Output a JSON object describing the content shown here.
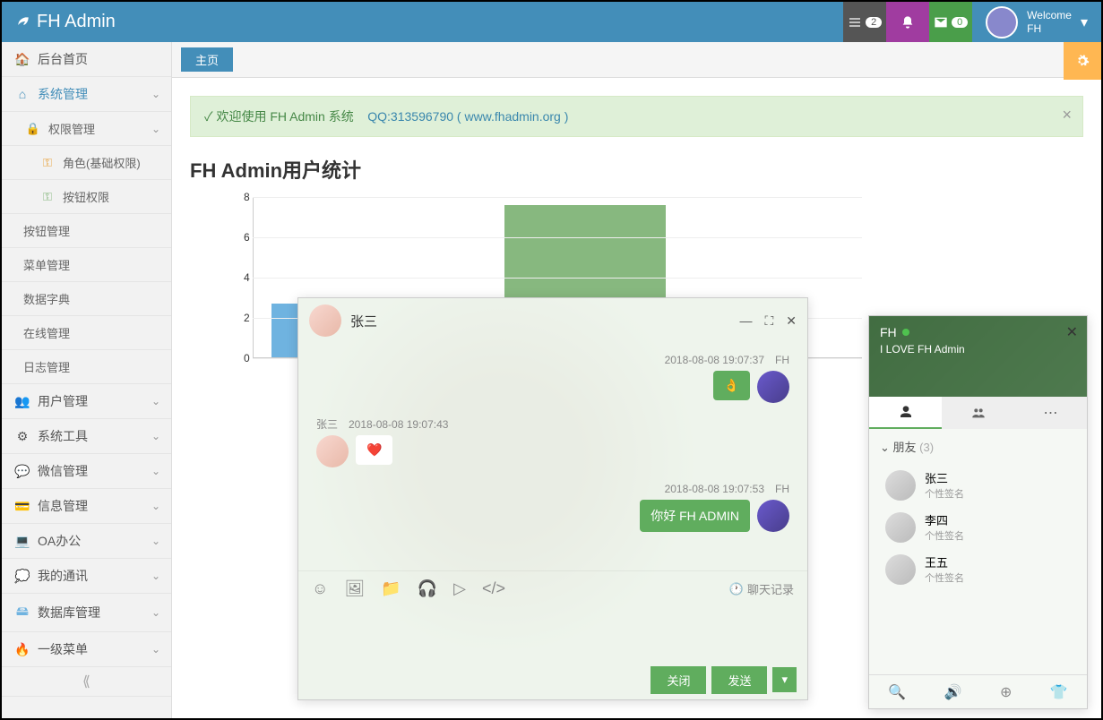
{
  "brand": "FH Admin",
  "header": {
    "badge_gray": "2",
    "badge_green": "0",
    "welcome_label": "Welcome",
    "username": "FH"
  },
  "tabs": {
    "main": "主页"
  },
  "alert": {
    "prefix": "✓ 欢迎使用 FH Admin 系统",
    "qq": "QQ:313596790",
    "link": "( www.fhadmin.org )"
  },
  "sidebar": {
    "home": "后台首页",
    "system": "系统管理",
    "permission": "权限管理",
    "role": "角色(基础权限)",
    "button_perm": "按钮权限",
    "button_mgmt": "按钮管理",
    "menu_mgmt": "菜单管理",
    "dict": "数据字典",
    "online": "在线管理",
    "log": "日志管理",
    "user_mgmt": "用户管理",
    "sys_tools": "系统工具",
    "wechat": "微信管理",
    "info": "信息管理",
    "oa": "OA办公",
    "comm": "我的通讯",
    "db": "数据库管理",
    "level1": "一级菜单"
  },
  "section_title": "FH Admin用户统计",
  "chart_data": {
    "type": "bar",
    "title": "FH Admin用户统计",
    "ylim": [
      0,
      8
    ],
    "yticks": [
      0,
      2,
      4,
      6,
      8
    ],
    "categories": [
      "",
      ""
    ],
    "values": [
      2.5,
      8
    ],
    "colors": [
      "#6fb3e0",
      "#87b87f"
    ]
  },
  "chat": {
    "contact": "张三",
    "messages": [
      {
        "side": "right",
        "meta": "2018-08-08 19:07:37　FH",
        "content": "👌"
      },
      {
        "side": "left",
        "meta": "张三　2018-08-08 19:07:43",
        "content": "❤️"
      },
      {
        "side": "right",
        "meta": "2018-08-08 19:07:53　FH",
        "content": "你好 FH ADMIN"
      }
    ],
    "history": "聊天记录",
    "close_btn": "关闭",
    "send_btn": "发送"
  },
  "friends": {
    "me": "FH",
    "signature": "I LOVE FH Admin",
    "group_label": "朋友",
    "group_count": "(3)",
    "list": [
      {
        "name": "张三",
        "sig": "个性签名"
      },
      {
        "name": "李四",
        "sig": "个性签名"
      },
      {
        "name": "王五",
        "sig": "个性签名"
      }
    ]
  }
}
